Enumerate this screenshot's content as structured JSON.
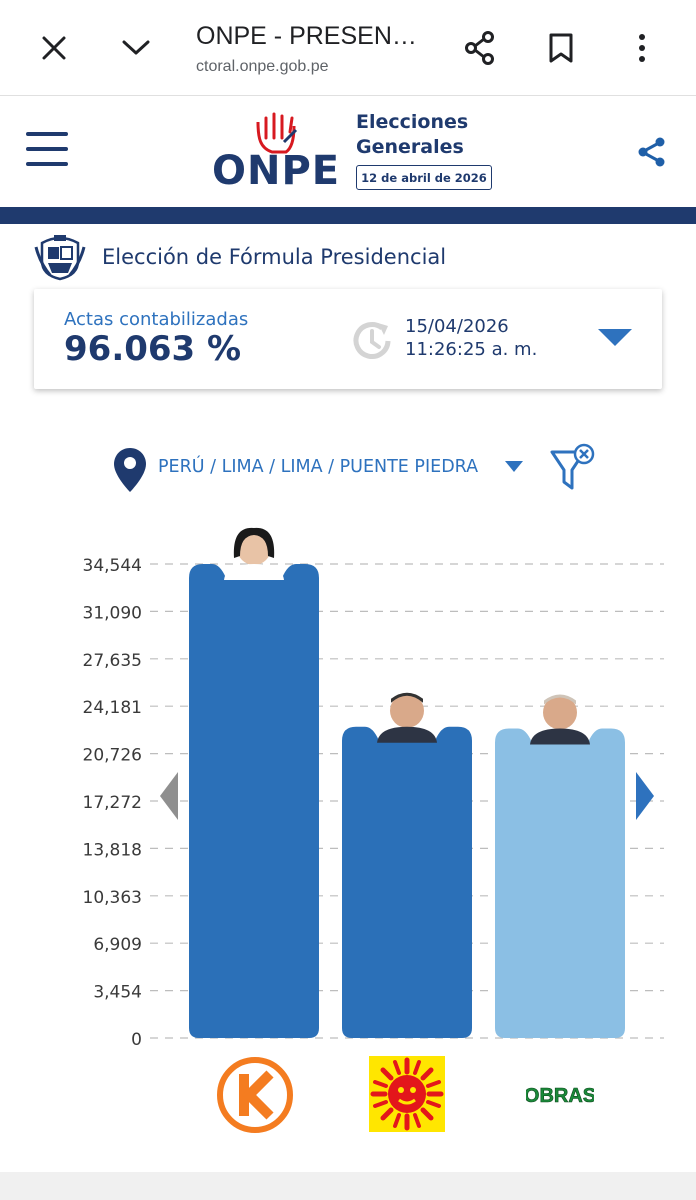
{
  "browser": {
    "title": "ONPE - PRESEN…",
    "url": "ctoral.onpe.gob.pe",
    "icons": [
      "close-icon",
      "chevron-down-icon",
      "share-icon",
      "bookmark-icon",
      "more-vert-icon"
    ]
  },
  "header": {
    "logo_text": "ONPE",
    "election_title": "Elecciones Generales",
    "election_date": "12 de abril de 2026",
    "colors": {
      "navy": "#1f3a6e",
      "accent_red": "#d71920"
    }
  },
  "election": {
    "heading": "Elección de Fórmula Presidencial"
  },
  "actas": {
    "label": "Actas contabilizadas",
    "value": "96.063 %",
    "date": "15/04/2026",
    "time": "11:26:25 a. m."
  },
  "location": {
    "path": "PERÚ / LIMA / LIMA / PUENTE PIEDRA"
  },
  "chart_data": {
    "type": "bar",
    "y_ticks": [
      "34,544",
      "31,090",
      "27,635",
      "24,181",
      "20,726",
      "17,272",
      "13,818",
      "10,363",
      "6,909",
      "3,454",
      "0"
    ],
    "ylim": [
      0,
      34544
    ],
    "grid": true,
    "values": [
      34544,
      22680,
      22560
    ],
    "colors": [
      "#2b70b8",
      "#2b70b8",
      "#8bbfe4"
    ],
    "party_logos": [
      "k-logo",
      "sun-logo",
      "obras-logo"
    ],
    "obras_text": "OBRAS"
  }
}
